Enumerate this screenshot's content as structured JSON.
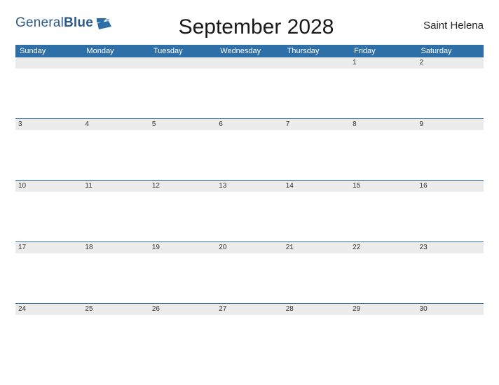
{
  "brand": {
    "word1": "General",
    "word2": "Blue"
  },
  "title": "September 2028",
  "region": "Saint Helena",
  "day_headers": [
    "Sunday",
    "Monday",
    "Tuesday",
    "Wednesday",
    "Thursday",
    "Friday",
    "Saturday"
  ],
  "weeks": [
    [
      "",
      "",
      "",
      "",
      "",
      "1",
      "2"
    ],
    [
      "3",
      "4",
      "5",
      "6",
      "7",
      "8",
      "9"
    ],
    [
      "10",
      "11",
      "12",
      "13",
      "14",
      "15",
      "16"
    ],
    [
      "17",
      "18",
      "19",
      "20",
      "21",
      "22",
      "23"
    ],
    [
      "24",
      "25",
      "26",
      "27",
      "28",
      "29",
      "30"
    ]
  ],
  "colors": {
    "accent": "#2f6fa8"
  }
}
